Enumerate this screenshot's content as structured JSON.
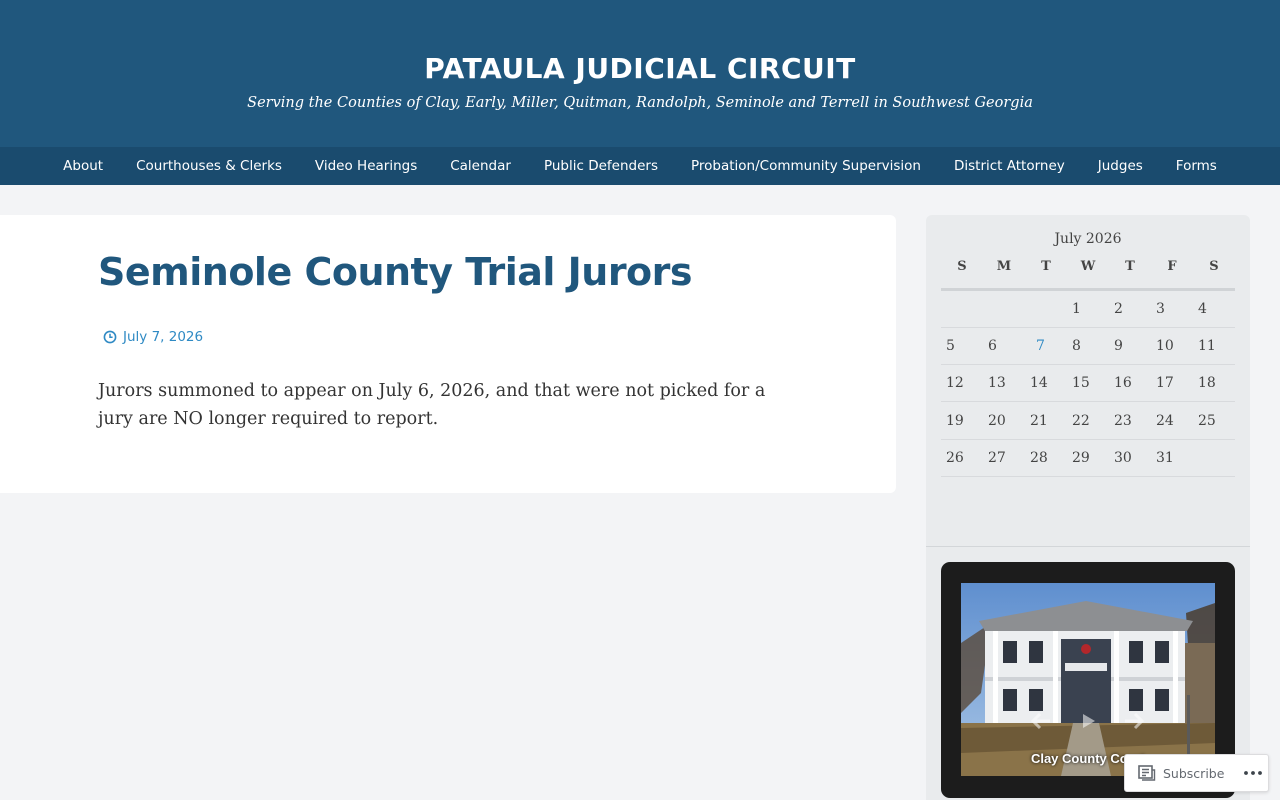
{
  "site": {
    "title": "PATAULA JUDICIAL CIRCUIT",
    "description": "Serving the Counties of Clay, Early, Miller, Quitman, Randolph, Seminole and Terrell in Southwest Georgia"
  },
  "nav": {
    "items": [
      {
        "label": "About"
      },
      {
        "label": "Courthouses & Clerks"
      },
      {
        "label": "Video Hearings"
      },
      {
        "label": "Calendar"
      },
      {
        "label": "Public Defenders"
      },
      {
        "label": "Probation/Community Supervision"
      },
      {
        "label": "District Attorney"
      },
      {
        "label": "Judges"
      },
      {
        "label": "Forms"
      }
    ]
  },
  "post": {
    "title": "Seminole County Trial Jurors",
    "date": "July 7, 2026",
    "body": "Jurors summoned to appear on July 6, 2026, and that were not picked for a jury are NO longer required to report."
  },
  "calendar": {
    "caption": "July 2026",
    "headers": [
      "S",
      "M",
      "T",
      "W",
      "T",
      "F",
      "S"
    ],
    "weeks": [
      [
        "",
        "",
        "",
        "1",
        "2",
        "3",
        "4"
      ],
      [
        "5",
        "6",
        "7",
        "8",
        "9",
        "10",
        "11"
      ],
      [
        "12",
        "13",
        "14",
        "15",
        "16",
        "17",
        "18"
      ],
      [
        "19",
        "20",
        "21",
        "22",
        "23",
        "24",
        "25"
      ],
      [
        "26",
        "27",
        "28",
        "29",
        "30",
        "31",
        ""
      ]
    ],
    "linked_day": "7"
  },
  "slideshow": {
    "caption": "Clay County Court"
  },
  "subscribe": {
    "label": "Subscribe"
  },
  "colors": {
    "header_bg": "#20577d",
    "nav_bg": "#1a4b6e",
    "title_blue": "#20577d",
    "link_blue": "#2f8ac4",
    "page_bg": "#f3f4f6",
    "sidebar_bg": "#e9ebed"
  },
  "icons": {
    "post_date": "clock-icon",
    "subscribe": "reader-icon",
    "more": "ellipsis-icon",
    "slideshow_prev": "arrow-left-icon",
    "slideshow_play": "play-icon",
    "slideshow_next": "arrow-right-icon"
  }
}
